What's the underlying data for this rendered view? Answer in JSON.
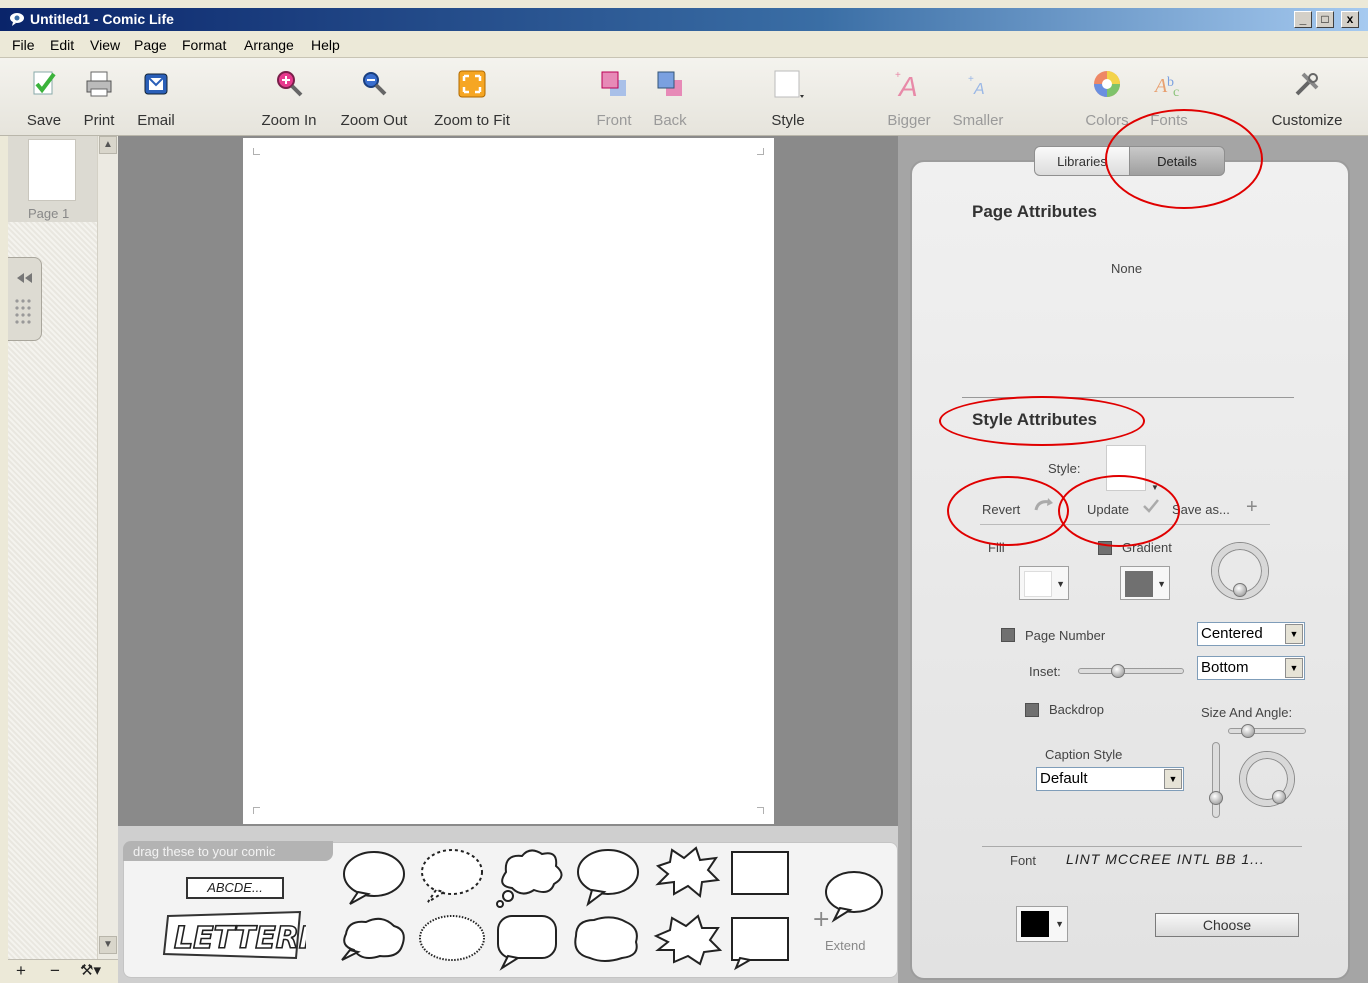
{
  "window": {
    "title": "Untitled1 - Comic Life",
    "min_label": "_",
    "max_label": "□",
    "close_label": "x"
  },
  "menu": [
    "File",
    "Edit",
    "View",
    "Page",
    "Format",
    "Arrange",
    "Help"
  ],
  "toolbar": {
    "save": "Save",
    "print": "Print",
    "email": "Email",
    "zoom_in": "Zoom In",
    "zoom_out": "Zoom Out",
    "zoom_fit": "Zoom to Fit",
    "front": "Front",
    "back": "Back",
    "style": "Style",
    "bigger": "Bigger",
    "smaller": "Smaller",
    "colors": "Colors",
    "fonts": "Fonts",
    "customize": "Customize"
  },
  "pages": {
    "page1": "Page 1"
  },
  "tray": {
    "tab_label": "drag these to your comic",
    "lettering_sample": "ABCDE...",
    "lettering_logo": "LETTERING",
    "extend": "Extend"
  },
  "panel": {
    "tabs": {
      "libraries": "Libraries",
      "details": "Details"
    },
    "page_attributes": {
      "heading": "Page Attributes",
      "value": "None"
    },
    "style_attributes": {
      "heading": "Style Attributes",
      "style_label": "Style:",
      "revert": "Revert",
      "update": "Update",
      "save_as": "Save as...",
      "fill": "Fill",
      "gradient": "Gradient",
      "page_number": "Page Number",
      "page_number_pos": "Centered",
      "page_number_vpos": "Bottom",
      "inset": "Inset:",
      "backdrop": "Backdrop",
      "size_angle": "Size And Angle:",
      "caption_style_label": "Caption Style",
      "caption_style_value": "Default",
      "font_label": "Font",
      "font_value": "LINT MCCREE INTL BB 1...",
      "choose": "Choose"
    }
  },
  "bottom_bar": {
    "add": "+",
    "remove": "−",
    "tools": "⚒▾"
  },
  "colors": {
    "annotation": "#e00000",
    "fill_swatch": "#ffffff",
    "gradient_swatch": "#707070",
    "font_swatch": "#000000"
  }
}
